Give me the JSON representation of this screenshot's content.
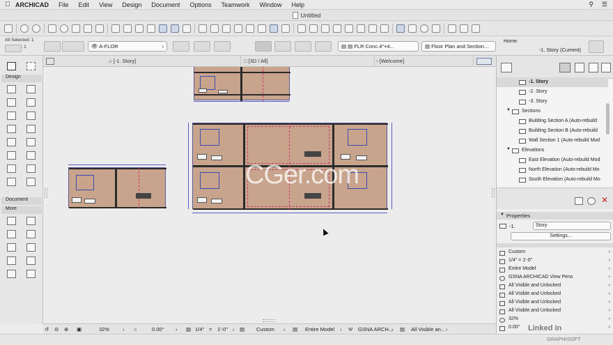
{
  "menubar": {
    "app": "ARCHICAD",
    "items": [
      "File",
      "Edit",
      "View",
      "Design",
      "Document",
      "Options",
      "Teamwork",
      "Window",
      "Help"
    ]
  },
  "window": {
    "title": "Untitled"
  },
  "infobox": {
    "selection": "All Selected: 1",
    "editable": "Editable: 1",
    "layer": "A-FLOR",
    "composite": "FLR Conc.4\"+4...",
    "view": "Floor Plan and Section...",
    "home_label": "Home:",
    "home_value": "-1. Story (Current)"
  },
  "tabs": [
    {
      "label": "[-1. Story]"
    },
    {
      "label": "[3D / All]"
    },
    {
      "label": "[Welcome]"
    }
  ],
  "toolbox": {
    "sections": [
      "Design",
      "Document",
      "More"
    ]
  },
  "navigator": {
    "rows": [
      {
        "label": "-1. Story",
        "selected": true
      },
      {
        "label": "-2. Story"
      },
      {
        "label": "-3. Story"
      },
      {
        "label": "Sections",
        "group": true
      },
      {
        "label": "Building Section A (Auto-rebuild"
      },
      {
        "label": "Building Section B (Auto-rebuild"
      },
      {
        "label": "Wall Section 1 (Auto-rebuild Mod"
      },
      {
        "label": "Elevations",
        "group": true
      },
      {
        "label": "East Elevation (Auto-rebuild Mod"
      },
      {
        "label": "North Elevation (Auto-rebuild Mo"
      },
      {
        "label": "South Elevation (Auto-rebuild Mo"
      }
    ]
  },
  "properties": {
    "header": "Properties",
    "id": "-1.",
    "name": "Story",
    "settings_label": "Settings...",
    "rows": [
      "Custom",
      "1/4\"   =    1'-0\"",
      "Entire Model",
      "GSNA ARCHICAD View Pens",
      "All Visible and Unlocked",
      "All Visible and Unlocked",
      "All Visible and Unlocked",
      "All Visible and Unlocked",
      "32%",
      "0.00°"
    ]
  },
  "statusbar": {
    "zoom": "32%",
    "angle": "0.00°",
    "scale_left": "1/4\"",
    "scale_eq": "=",
    "scale_right": "1'-0\"",
    "structure": "Custom",
    "model": "Entire Model",
    "pens": "GSNA ARCH...",
    "visibility": "All Visible an..."
  },
  "watermark": "CGer.com",
  "branding": {
    "line1": "Linked in",
    "line2": "GRAPHISOFT"
  }
}
